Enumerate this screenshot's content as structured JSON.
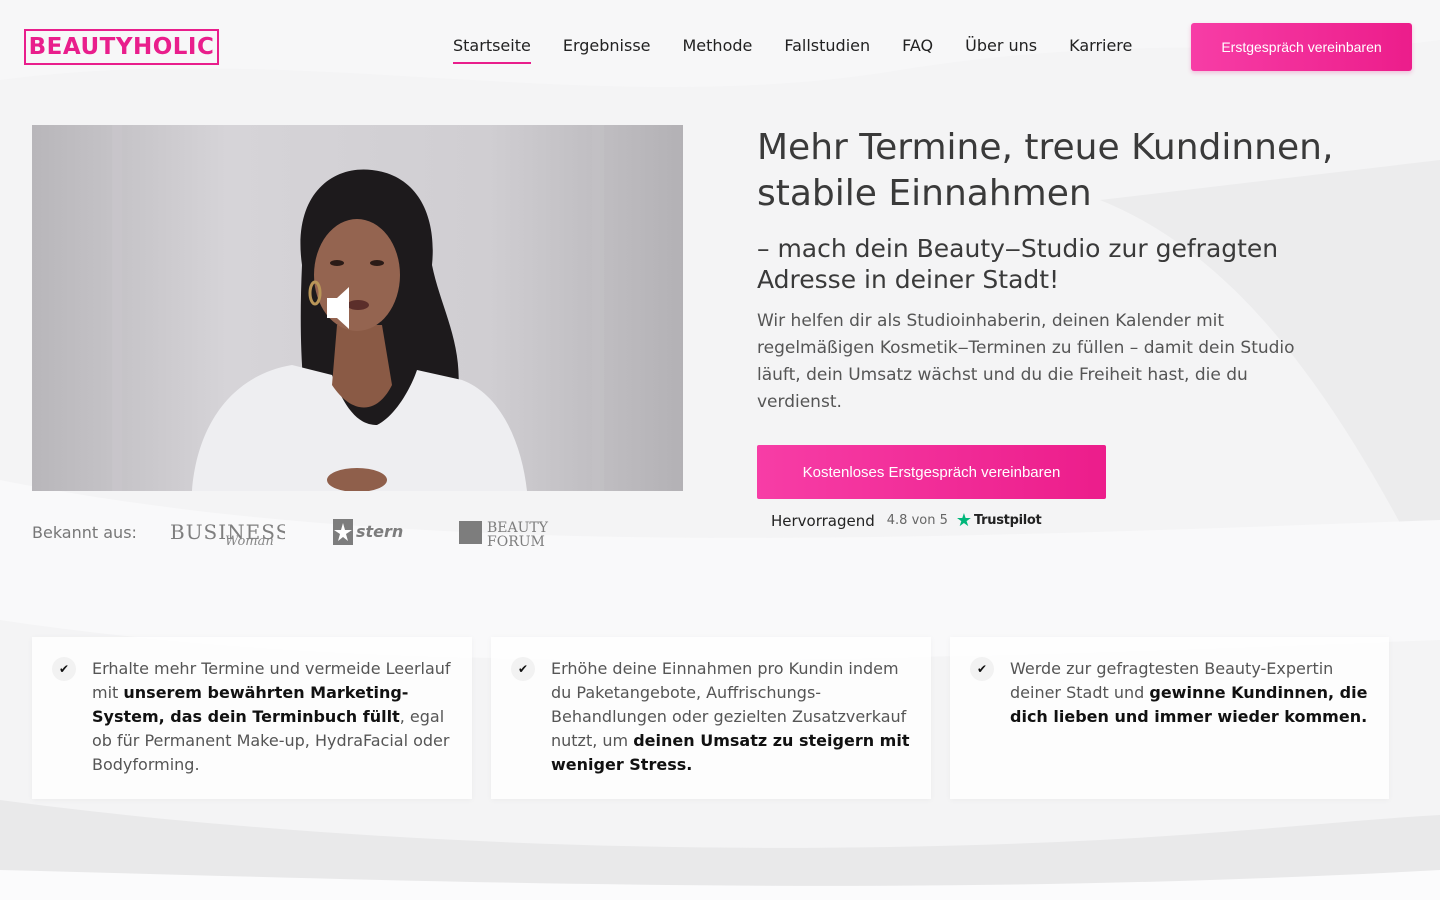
{
  "brand": {
    "logo_text": "BEAUTYHOLIC",
    "accent": "#e91e8c"
  },
  "nav": {
    "items": [
      {
        "label": "Startseite",
        "active": true
      },
      {
        "label": "Ergebnisse"
      },
      {
        "label": "Methode"
      },
      {
        "label": "Fallstudien"
      },
      {
        "label": "FAQ"
      },
      {
        "label": "Über uns"
      },
      {
        "label": "Karriere"
      }
    ],
    "cta_label": "Erstgespräch vereinbaren"
  },
  "hero": {
    "headline": "Mehr Termine, treue Kundinnen, stabile Einnahmen",
    "subheadline": "– mach dein Beauty‒Studio zur gefragten Adresse in deiner Stadt!",
    "description": "Wir helfen dir als Studioinhaberin, deinen Kalender mit regelmäßigen Kosmetik‒Terminen zu füllen – damit dein Studio läuft, dein Umsatz wächst und du die Freiheit hast, die du verdienst.",
    "cta_label": "Kostenloses Erstgespräch vereinbaren",
    "video_icon": "speaker-muted-icon"
  },
  "known_from": {
    "label": "Bekannt aus:",
    "logos": [
      {
        "text": "BUSINESS",
        "script": "Woman"
      },
      {
        "text": "stern"
      },
      {
        "line1": "BEAUTY",
        "line2": "FORUM"
      }
    ]
  },
  "rating": {
    "word": "Hervorragend",
    "score": "4.8 von 5",
    "provider": "Trustpilot",
    "star_color": "#00b67a"
  },
  "features": [
    {
      "pre": "Erhalte mehr Termine und vermeide Leerlauf mit ",
      "bold": "unserem bewährten Marketing-System, das dein Terminbuch füllt",
      "post": ", egal ob für Permanent Make-up, HydraFacial oder Bodyforming."
    },
    {
      "pre": "Erhöhe deine Einnahmen pro Kundin indem du Paketangebote, Auffrischungs-Behandlungen oder gezielten Zusatzverkauf nutzt, um ",
      "bold": "deinen Umsatz zu steigern mit weniger Stress.",
      "post": ""
    },
    {
      "pre": "Werde zur gefragtesten Beauty-Expertin deiner Stadt und ",
      "bold": "gewinne Kundinnen, die dich lieben und immer wieder kommen.",
      "post": ""
    }
  ]
}
